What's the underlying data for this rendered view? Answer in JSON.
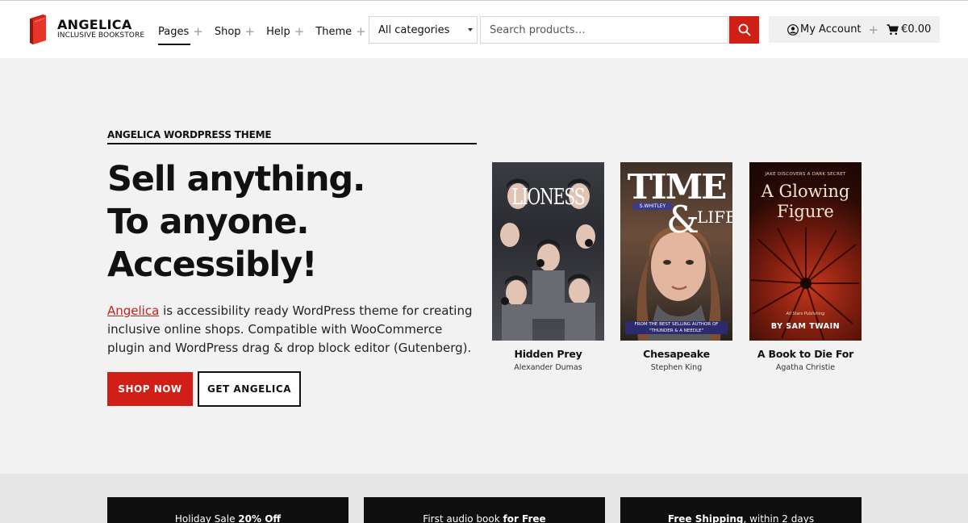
{
  "brand": {
    "title": "ANGELICA",
    "subtitle": "INCLUSIVE BOOKSTORE",
    "accent": "#d01f16"
  },
  "nav": [
    {
      "label": "Pages"
    },
    {
      "label": "Shop"
    },
    {
      "label": "Help"
    },
    {
      "label": "Theme"
    }
  ],
  "search": {
    "category": "All categories",
    "placeholder": "Search products…"
  },
  "account": {
    "label": "My Account",
    "cart_total": "€0.00"
  },
  "hero": {
    "eyebrow": "ANGELICA WORDPRESS THEME",
    "headline": [
      "Sell anything.",
      "To anyone.",
      "Accessibly!"
    ],
    "link_text": "Angelica",
    "description": " is accessibility ready WordPress theme for creating inclusive online shops. Compatible with WooCommerce plugin and WordPress drag & drop block editor (Gutenberg).",
    "primary_button": "SHOP NOW",
    "secondary_button": "GET ANGELICA"
  },
  "books": [
    {
      "title": "Hidden Prey",
      "author": "Alexander Dumas",
      "cover_title": "LIONESS"
    },
    {
      "title": "Chesapeake",
      "author": "Stephen King",
      "cover_title": "TIME",
      "cover_amp": "&",
      "cover_title2": "LIFE",
      "cover_author": "S.WHITLEY",
      "cover_footer": "FROM THE BEST SELLING AUTHOR OF \"THUNDER & A NEEDLE\""
    },
    {
      "title": "A Book to Die For",
      "author": "Agatha Christie",
      "cover_tagline": "JAKE DISCOVERS A DARK SECRET",
      "cover_title": "A Glowing Figure",
      "cover_publisher": "All Stars Publishing",
      "cover_author": "BY SAM TWAIN"
    }
  ],
  "promos": [
    {
      "text": "Holiday Sale ",
      "bold": "20% Off",
      "text_after": ""
    },
    {
      "text": "First audio book ",
      "bold": "for Free",
      "text_after": ""
    },
    {
      "text": "",
      "bold": "Free Shipping",
      "text_after": ", within 2 days"
    }
  ]
}
